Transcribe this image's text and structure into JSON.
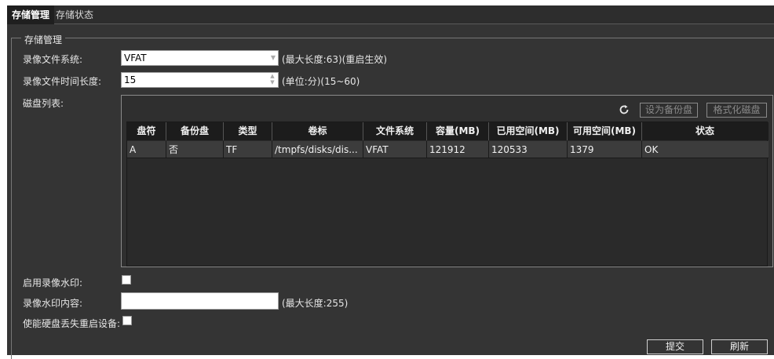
{
  "tabs": [
    {
      "label": "存储管理"
    },
    {
      "label": "存储状态"
    }
  ],
  "group": {
    "title": "存储管理"
  },
  "form": {
    "fs_label": "录像文件系统:",
    "fs_value": "VFAT",
    "fs_hint": "(最大长度:63)(重启生效)",
    "duration_label": "录像文件时间长度:",
    "duration_value": "15",
    "duration_hint": "(单位:分)(15~60)",
    "disk_list_label": "磁盘列表:",
    "watermark_enable_label": "启用录像水印:",
    "watermark_enabled": false,
    "watermark_content_label": "录像水印内容:",
    "watermark_content_value": "",
    "watermark_content_hint": "(最大长度:255)",
    "reboot_on_disk_loss_label": "使能硬盘丢失重启设备:",
    "reboot_on_disk_loss": false
  },
  "disk_toolbar": {
    "set_backup_label": "设为备份盘",
    "format_label": "格式化磁盘"
  },
  "disk_table": {
    "columns": [
      "盘符",
      "备份盘",
      "类型",
      "卷标",
      "文件系统",
      "容量(MB)",
      "已用空间(MB)",
      "可用空间(MB)",
      "状态"
    ],
    "rows": [
      [
        "A",
        "否",
        "TF",
        "/tmpfs/disks/dis...",
        "VFAT",
        "121912",
        "120533",
        "1379",
        "OK"
      ]
    ]
  },
  "actions": {
    "submit_label": "提交",
    "refresh_label": "刷新"
  }
}
